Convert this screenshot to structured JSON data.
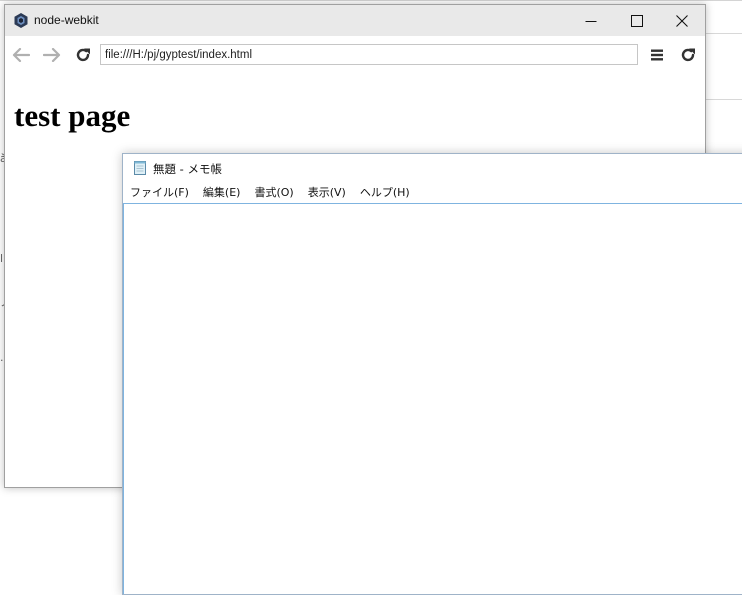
{
  "node_webkit": {
    "title": "node-webkit",
    "url": "file:///H:/pj/gyptest/index.html",
    "page_heading": "test page"
  },
  "notepad": {
    "title": "無題 - メモ帳",
    "menu": [
      {
        "label": "ファイル(F)"
      },
      {
        "label": "編集(E)"
      },
      {
        "label": "書式(O)"
      },
      {
        "label": "表示(V)"
      },
      {
        "label": "ヘルプ(H)"
      }
    ],
    "editor_text": ""
  },
  "icons": {
    "app": "node-webkit-icon",
    "back": "arrow-left-icon",
    "forward": "arrow-right-icon",
    "reload": "reload-icon",
    "menu": "hamburger-menu-icon",
    "devtools_reload": "reload-icon",
    "minimize": "minimize-icon",
    "maximize": "maximize-icon",
    "close": "close-icon",
    "notepad": "notepad-icon"
  },
  "colors": {
    "titlebar": "#e9e9e9",
    "notepad_border": "#7fb4e0",
    "nav_disabled": "#b0b0b0",
    "icon_dark": "#333333"
  }
}
